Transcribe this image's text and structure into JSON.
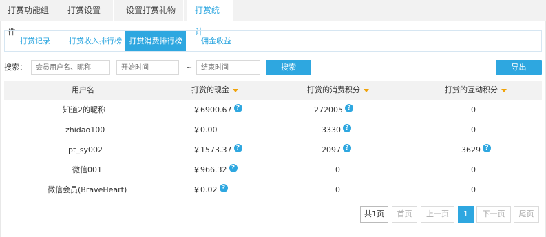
{
  "top_tabs": [
    {
      "label": "打赏功能组件"
    },
    {
      "label": "打赏设置"
    },
    {
      "label": "设置打赏礼物"
    },
    {
      "label": "打赏统计"
    }
  ],
  "sub_tabs": [
    {
      "label": "打赏记录"
    },
    {
      "label": "打赏收入排行榜"
    },
    {
      "label": "打赏消费排行榜"
    },
    {
      "label": "佣金收益"
    }
  ],
  "search": {
    "label": "搜索：",
    "member_placeholder": "会员用户名、昵称",
    "start_placeholder": "开始时间",
    "separator": "~",
    "end_placeholder": "结束时间",
    "search_button": "搜索",
    "export_button": "导出"
  },
  "table": {
    "headers": [
      "用户名",
      "打赏的现金",
      "打赏的消费积分",
      "打赏的互动积分"
    ],
    "rows": [
      {
        "user": "知道2的昵称",
        "cash": "￥6900.67",
        "consume": "272005",
        "interact": "0"
      },
      {
        "user": "zhidao100",
        "cash": "￥0.00",
        "consume": "3330",
        "interact": "0"
      },
      {
        "user": "pt_sy002",
        "cash": "￥1573.37",
        "consume": "2097",
        "interact": "3629"
      },
      {
        "user": "微信001",
        "cash": "￥966.32",
        "consume": "0",
        "interact": "0"
      },
      {
        "user": "微信会员(BraveHeart)",
        "cash": "￥0.02",
        "consume": "0",
        "interact": "0"
      }
    ],
    "help_icon_char": "?"
  },
  "pager": {
    "total": "共1页",
    "first": "首页",
    "prev": "上一页",
    "current": "1",
    "next": "下一页",
    "last": "尾页"
  },
  "colors": {
    "accent": "#2ea7e0",
    "caret": "#f0a30a"
  }
}
